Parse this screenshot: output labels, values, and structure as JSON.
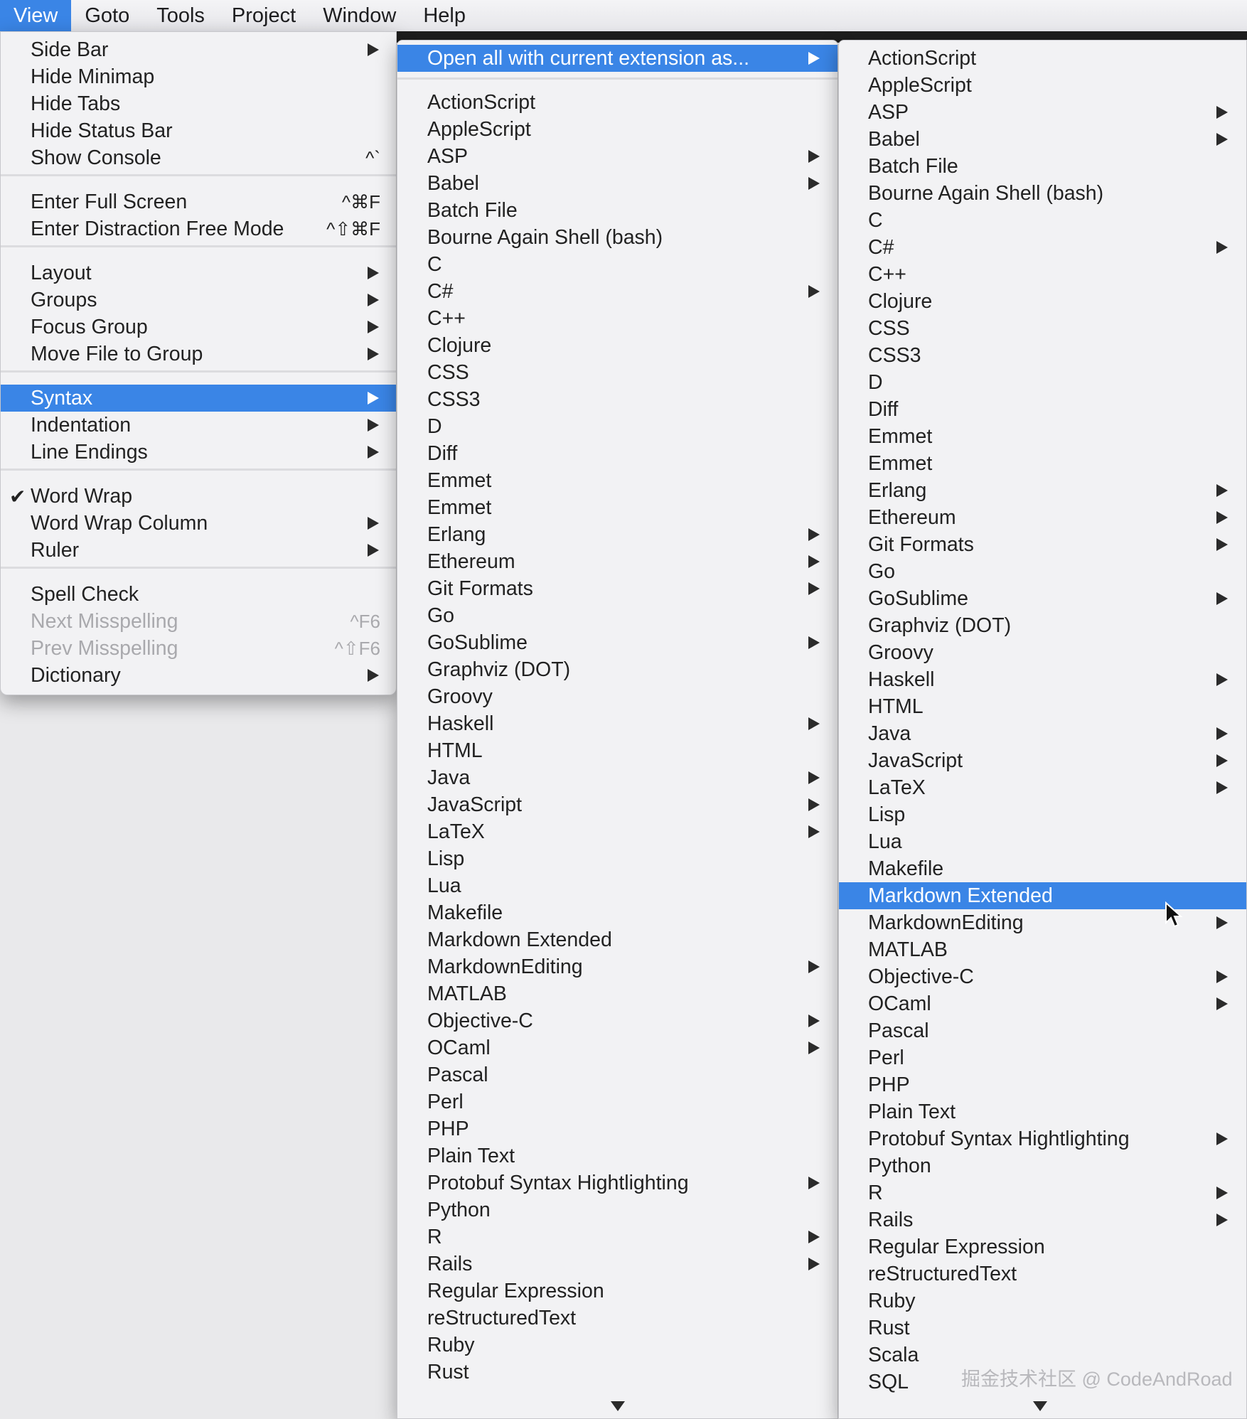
{
  "menubar": {
    "items": [
      "View",
      "Goto",
      "Tools",
      "Project",
      "Window",
      "Help"
    ],
    "active_index": 0
  },
  "view_menu": {
    "groups": [
      [
        {
          "label": "Side Bar",
          "submenu": true
        },
        {
          "label": "Hide Minimap"
        },
        {
          "label": "Hide Tabs"
        },
        {
          "label": "Hide Status Bar"
        },
        {
          "label": "Show Console",
          "shortcut": "^`"
        }
      ],
      [
        {
          "label": "Enter Full Screen",
          "shortcut": "^⌘F"
        },
        {
          "label": "Enter Distraction Free Mode",
          "shortcut": "^⇧⌘F"
        }
      ],
      [
        {
          "label": "Layout",
          "submenu": true
        },
        {
          "label": "Groups",
          "submenu": true
        },
        {
          "label": "Focus Group",
          "submenu": true
        },
        {
          "label": "Move File to Group",
          "submenu": true
        }
      ],
      [
        {
          "label": "Syntax",
          "submenu": true,
          "highlighted": true
        },
        {
          "label": "Indentation",
          "submenu": true
        },
        {
          "label": "Line Endings",
          "submenu": true
        }
      ],
      [
        {
          "label": "Word Wrap",
          "checked": true
        },
        {
          "label": "Word Wrap Column",
          "submenu": true
        },
        {
          "label": "Ruler",
          "submenu": true
        }
      ],
      [
        {
          "label": "Spell Check"
        },
        {
          "label": "Next Misspelling",
          "shortcut": "^F6",
          "disabled": true
        },
        {
          "label": "Prev Misspelling",
          "shortcut": "^⇧F6",
          "disabled": true
        },
        {
          "label": "Dictionary",
          "submenu": true
        }
      ]
    ]
  },
  "syntax_submenu": {
    "header": {
      "label": "Open all with current extension as...",
      "submenu": true,
      "highlighted": true
    },
    "items": [
      {
        "label": "ActionScript"
      },
      {
        "label": "AppleScript"
      },
      {
        "label": "ASP",
        "submenu": true
      },
      {
        "label": "Babel",
        "submenu": true
      },
      {
        "label": "Batch File"
      },
      {
        "label": "Bourne Again Shell (bash)"
      },
      {
        "label": "C"
      },
      {
        "label": "C#",
        "submenu": true
      },
      {
        "label": "C++"
      },
      {
        "label": "Clojure"
      },
      {
        "label": "CSS"
      },
      {
        "label": "CSS3"
      },
      {
        "label": "D"
      },
      {
        "label": "Diff"
      },
      {
        "label": "Emmet"
      },
      {
        "label": "Emmet"
      },
      {
        "label": "Erlang",
        "submenu": true
      },
      {
        "label": "Ethereum",
        "submenu": true
      },
      {
        "label": "Git Formats",
        "submenu": true
      },
      {
        "label": "Go"
      },
      {
        "label": "GoSublime",
        "submenu": true
      },
      {
        "label": "Graphviz (DOT)"
      },
      {
        "label": "Groovy"
      },
      {
        "label": "Haskell",
        "submenu": true
      },
      {
        "label": "HTML"
      },
      {
        "label": "Java",
        "submenu": true
      },
      {
        "label": "JavaScript",
        "submenu": true
      },
      {
        "label": "LaTeX",
        "submenu": true
      },
      {
        "label": "Lisp"
      },
      {
        "label": "Lua"
      },
      {
        "label": "Makefile"
      },
      {
        "label": "Markdown Extended"
      },
      {
        "label": "MarkdownEditing",
        "submenu": true
      },
      {
        "label": "MATLAB"
      },
      {
        "label": "Objective-C",
        "submenu": true
      },
      {
        "label": "OCaml",
        "submenu": true
      },
      {
        "label": "Pascal"
      },
      {
        "label": "Perl"
      },
      {
        "label": "PHP"
      },
      {
        "label": "Plain Text"
      },
      {
        "label": "Protobuf Syntax Hightlighting",
        "submenu": true
      },
      {
        "label": "Python"
      },
      {
        "label": "R",
        "submenu": true
      },
      {
        "label": "Rails",
        "submenu": true
      },
      {
        "label": "Regular Expression"
      },
      {
        "label": "reStructuredText"
      },
      {
        "label": "Ruby"
      },
      {
        "label": "Rust"
      }
    ]
  },
  "extension_submenu": {
    "items": [
      {
        "label": "ActionScript"
      },
      {
        "label": "AppleScript"
      },
      {
        "label": "ASP",
        "submenu": true
      },
      {
        "label": "Babel",
        "submenu": true
      },
      {
        "label": "Batch File"
      },
      {
        "label": "Bourne Again Shell (bash)"
      },
      {
        "label": "C"
      },
      {
        "label": "C#",
        "submenu": true
      },
      {
        "label": "C++"
      },
      {
        "label": "Clojure"
      },
      {
        "label": "CSS"
      },
      {
        "label": "CSS3"
      },
      {
        "label": "D"
      },
      {
        "label": "Diff"
      },
      {
        "label": "Emmet"
      },
      {
        "label": "Emmet"
      },
      {
        "label": "Erlang",
        "submenu": true
      },
      {
        "label": "Ethereum",
        "submenu": true
      },
      {
        "label": "Git Formats",
        "submenu": true
      },
      {
        "label": "Go"
      },
      {
        "label": "GoSublime",
        "submenu": true
      },
      {
        "label": "Graphviz (DOT)"
      },
      {
        "label": "Groovy"
      },
      {
        "label": "Haskell",
        "submenu": true
      },
      {
        "label": "HTML"
      },
      {
        "label": "Java",
        "submenu": true
      },
      {
        "label": "JavaScript",
        "submenu": true
      },
      {
        "label": "LaTeX",
        "submenu": true
      },
      {
        "label": "Lisp"
      },
      {
        "label": "Lua"
      },
      {
        "label": "Makefile"
      },
      {
        "label": "Markdown Extended",
        "highlighted": true
      },
      {
        "label": "MarkdownEditing",
        "submenu": true
      },
      {
        "label": "MATLAB"
      },
      {
        "label": "Objective-C",
        "submenu": true
      },
      {
        "label": "OCaml",
        "submenu": true
      },
      {
        "label": "Pascal"
      },
      {
        "label": "Perl"
      },
      {
        "label": "PHP"
      },
      {
        "label": "Plain Text"
      },
      {
        "label": "Protobuf Syntax Hightlighting",
        "submenu": true
      },
      {
        "label": "Python"
      },
      {
        "label": "R",
        "submenu": true
      },
      {
        "label": "Rails",
        "submenu": true
      },
      {
        "label": "Regular Expression"
      },
      {
        "label": "reStructuredText"
      },
      {
        "label": "Ruby"
      },
      {
        "label": "Rust"
      },
      {
        "label": "Scala"
      },
      {
        "label": "SQL"
      }
    ]
  },
  "icons": {
    "checkmark": "checkmark-icon",
    "submenu": "chevron-right-icon",
    "scroll_down": "scroll-down-arrow-icon",
    "cursor": "mouse-pointer-icon"
  },
  "colors": {
    "highlight": "#3a85e6",
    "menu_bg": "#f2f2f4",
    "disabled_text": "#a9a9ad"
  },
  "watermark": "掘金技术社区 @ CodeAndRoad"
}
